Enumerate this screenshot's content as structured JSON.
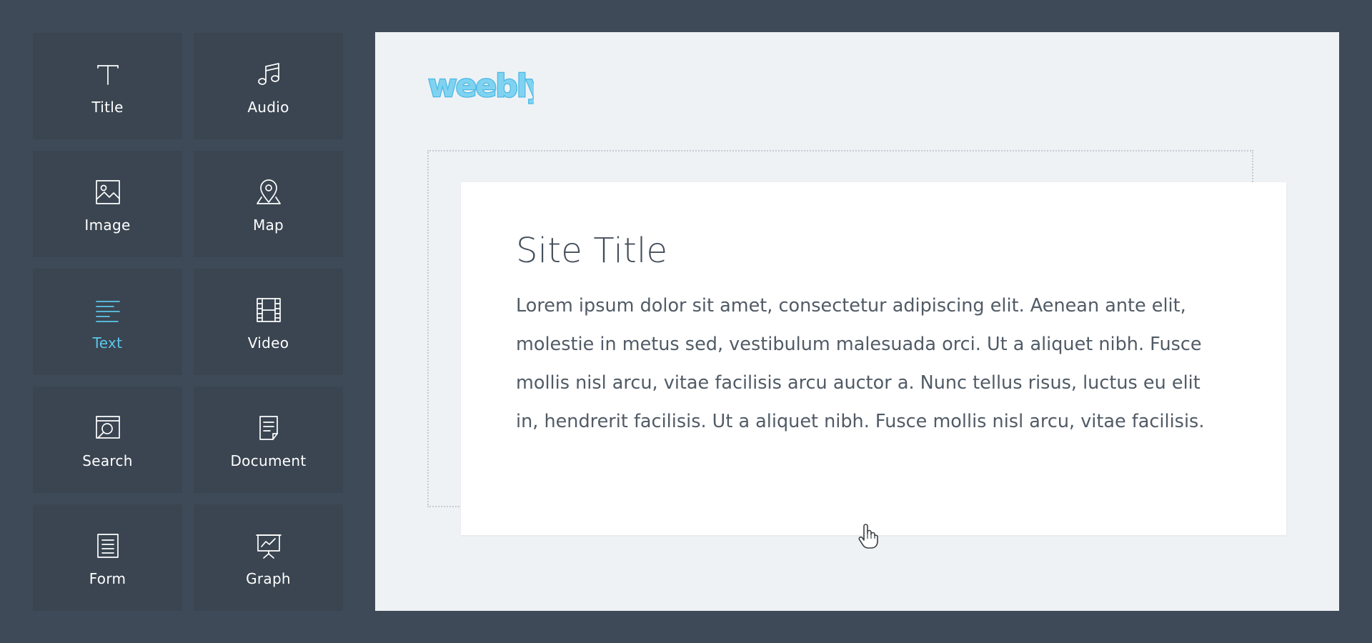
{
  "sidebar": {
    "items": [
      {
        "label": "Title",
        "icon": "title-icon"
      },
      {
        "label": "Audio",
        "icon": "music-note-icon"
      },
      {
        "label": "Image",
        "icon": "image-icon"
      },
      {
        "label": "Map",
        "icon": "map-pin-icon"
      },
      {
        "label": "Text",
        "icon": "text-lines-icon",
        "active": true
      },
      {
        "label": "Video",
        "icon": "film-icon"
      },
      {
        "label": "Search",
        "icon": "search-page-icon"
      },
      {
        "label": "Document",
        "icon": "document-icon"
      },
      {
        "label": "Form",
        "icon": "form-icon"
      },
      {
        "label": "Graph",
        "icon": "presentation-graph-icon"
      }
    ]
  },
  "canvas": {
    "logo_text": "weebly",
    "card": {
      "title": "Site Title",
      "body": "Lorem ipsum dolor sit amet, consectetur adipiscing elit. Aenean ante elit, molestie in metus sed, vestibulum malesuada orci. Ut a aliquet nibh. Fusce mollis nisl arcu, vitae facilisis arcu auctor a. Nunc tellus risus, luctus eu elit in, hendrerit facilisis. Ut a aliquet nibh. Fusce mollis nisl arcu, vitae facilisis."
    }
  },
  "colors": {
    "background": "#3e4a57",
    "tile": "#3a4551",
    "accent": "#5cc6ea",
    "canvas": "#eff2f5",
    "text": "#515b66"
  }
}
